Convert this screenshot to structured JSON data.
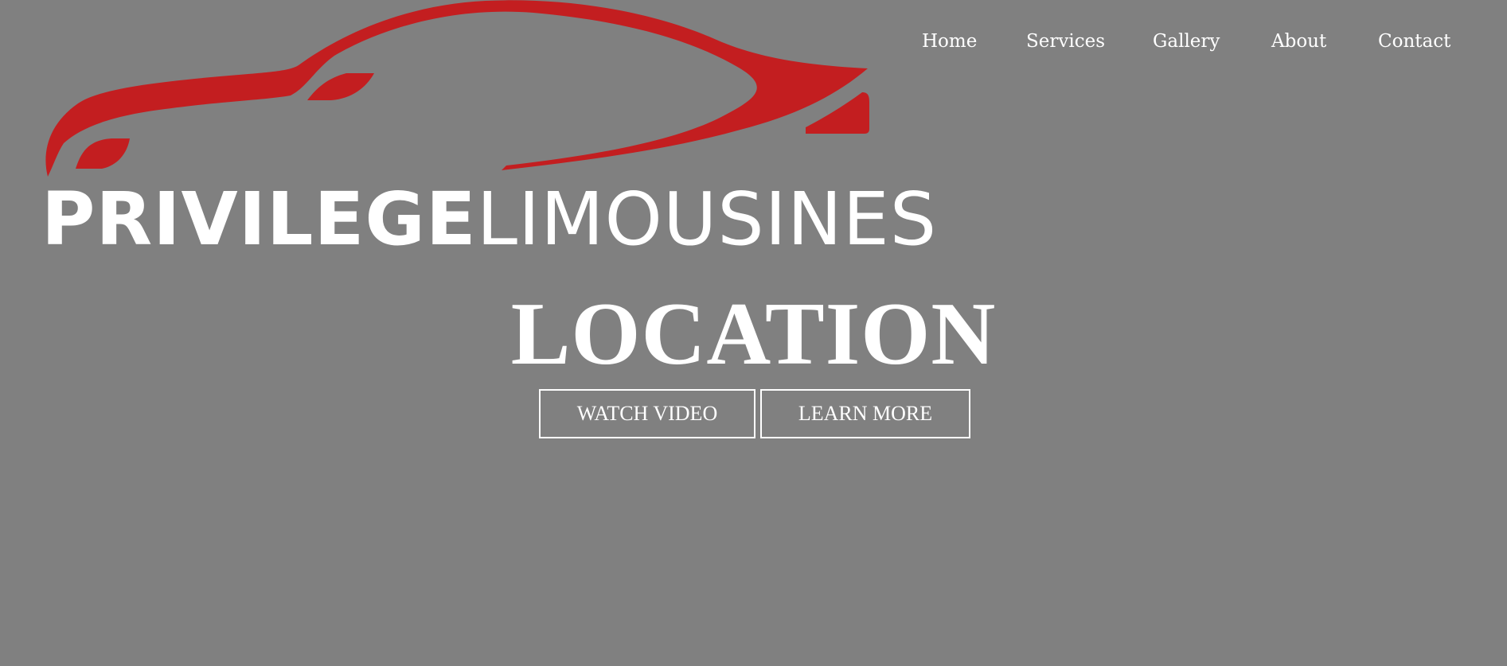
{
  "logo": {
    "text_bold": "PRIVILEGE",
    "text_light": "LIMOUSINES",
    "color_text": "#ffffff",
    "color_car": "#c31e20",
    "icon": "car-silhouette-icon"
  },
  "nav": {
    "items": [
      {
        "label": "Home"
      },
      {
        "label": "Services"
      },
      {
        "label": "Gallery"
      },
      {
        "label": "About"
      },
      {
        "label": "Contact"
      }
    ]
  },
  "hero": {
    "title": "LOCATION",
    "buttons": {
      "watch_video": "WATCH VIDEO",
      "learn_more": "LEARN MORE"
    }
  },
  "colors": {
    "background": "#808080",
    "text": "#ffffff",
    "accent": "#c31e20"
  }
}
